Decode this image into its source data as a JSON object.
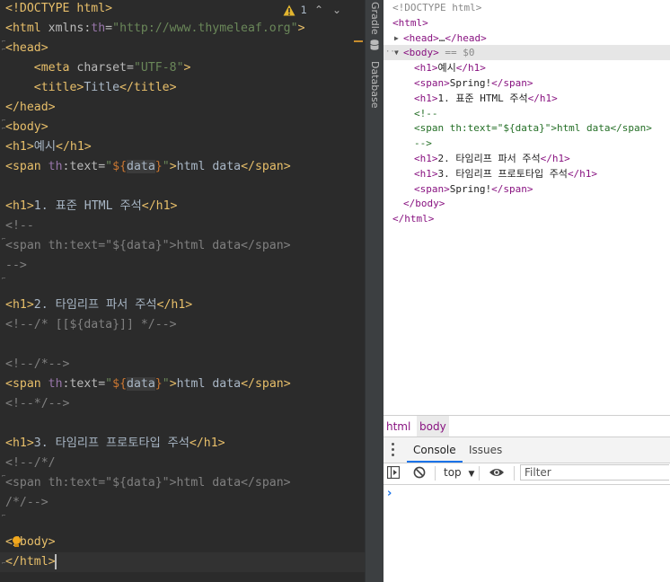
{
  "editor": {
    "warning_count": "1",
    "lines": [
      [
        {
          "c": "t-tag",
          "t": "<!DOCTYPE "
        },
        {
          "c": "t-tag",
          "t": "html"
        },
        {
          "c": "t-tag",
          "t": ">"
        }
      ],
      [
        {
          "c": "t-tag",
          "t": "<html "
        },
        {
          "c": "t-attr",
          "t": "xmlns:"
        },
        {
          "c": "t-ns",
          "t": "th"
        },
        {
          "c": "t-attr",
          "t": "="
        },
        {
          "c": "t-str",
          "t": "\"http://www.thymeleaf.org\""
        },
        {
          "c": "t-tag",
          "t": ">"
        }
      ],
      [
        {
          "c": "t-tag",
          "t": "<head>"
        }
      ],
      [
        {
          "c": "t-txt",
          "t": "    "
        },
        {
          "c": "t-tag",
          "t": "<meta "
        },
        {
          "c": "t-attr",
          "t": "charset="
        },
        {
          "c": "t-str",
          "t": "\"UTF-8\""
        },
        {
          "c": "t-tag",
          "t": ">"
        }
      ],
      [
        {
          "c": "t-txt",
          "t": "    "
        },
        {
          "c": "t-tag",
          "t": "<title>"
        },
        {
          "c": "t-txt",
          "t": "Title"
        },
        {
          "c": "t-tag",
          "t": "</title>"
        }
      ],
      [
        {
          "c": "t-tag",
          "t": "</head>"
        }
      ],
      [
        {
          "c": "t-tag",
          "t": "<body>"
        }
      ],
      [
        {
          "c": "t-tag",
          "t": "<h1>"
        },
        {
          "c": "t-txt",
          "t": "예시"
        },
        {
          "c": "t-tag",
          "t": "</h1>"
        }
      ],
      [
        {
          "c": "t-tag",
          "t": "<span "
        },
        {
          "c": "t-ns",
          "t": "th"
        },
        {
          "c": "t-attr",
          "t": ":text="
        },
        {
          "c": "t-str",
          "t": "\""
        },
        {
          "c": "t-brace",
          "t": "${"
        },
        {
          "c": "t-expr",
          "t": "data"
        },
        {
          "c": "t-brace",
          "t": "}"
        },
        {
          "c": "t-str",
          "t": "\""
        },
        {
          "c": "t-tag",
          "t": ">"
        },
        {
          "c": "t-txt",
          "t": "html data"
        },
        {
          "c": "t-tag",
          "t": "</span>"
        }
      ],
      [],
      [
        {
          "c": "t-tag",
          "t": "<h1>"
        },
        {
          "c": "t-txt",
          "t": "1. 표준 HTML 주석"
        },
        {
          "c": "t-tag",
          "t": "</h1>"
        }
      ],
      [
        {
          "c": "t-cm",
          "t": "<!--"
        }
      ],
      [
        {
          "c": "t-cm",
          "t": "<span th:text=\"${data}\">html data</span>"
        }
      ],
      [
        {
          "c": "t-cm",
          "t": "-->"
        }
      ],
      [],
      [
        {
          "c": "t-tag",
          "t": "<h1>"
        },
        {
          "c": "t-txt",
          "t": "2. 타임리프 파서 주석"
        },
        {
          "c": "t-tag",
          "t": "</h1>"
        }
      ],
      [
        {
          "c": "t-cm",
          "t": "<!--/* [[${data}]] */-->"
        }
      ],
      [],
      [
        {
          "c": "t-cm",
          "t": "<!--/*-->"
        }
      ],
      [
        {
          "c": "t-tag",
          "t": "<span "
        },
        {
          "c": "t-ns",
          "t": "th"
        },
        {
          "c": "t-attr",
          "t": ":text="
        },
        {
          "c": "t-str",
          "t": "\""
        },
        {
          "c": "t-brace",
          "t": "${"
        },
        {
          "c": "t-expr",
          "t": "data"
        },
        {
          "c": "t-brace",
          "t": "}"
        },
        {
          "c": "t-str",
          "t": "\""
        },
        {
          "c": "t-tag",
          "t": ">"
        },
        {
          "c": "t-txt",
          "t": "html data"
        },
        {
          "c": "t-tag",
          "t": "</span>"
        }
      ],
      [
        {
          "c": "t-cm",
          "t": "<!--*/-->"
        }
      ],
      [],
      [
        {
          "c": "t-tag",
          "t": "<h1>"
        },
        {
          "c": "t-txt",
          "t": "3. 타임리프 프로토타입 주석"
        },
        {
          "c": "t-tag",
          "t": "</h1>"
        }
      ],
      [
        {
          "c": "t-cm",
          "t": "<!--/*/"
        }
      ],
      [
        {
          "c": "t-cm",
          "t": "<span th:text=\"${data}\">html data</span>"
        }
      ],
      [
        {
          "c": "t-cm",
          "t": "/*/-->"
        }
      ],
      [],
      [
        {
          "c": "t-tag",
          "t": "</body>"
        }
      ],
      [
        {
          "c": "t-tag",
          "t": "</html>"
        }
      ]
    ]
  },
  "toolstrip": {
    "gradle_label": "Gradle",
    "database_label": "Database"
  },
  "devtools": {
    "elements": [
      {
        "indent": 0,
        "parts": [
          {
            "c": "dt-dim",
            "t": "<!DOCTYPE html>"
          }
        ]
      },
      {
        "indent": 0,
        "parts": [
          {
            "c": "dt-tag",
            "t": "<html>"
          }
        ]
      },
      {
        "indent": 1,
        "arrow": "▶",
        "parts": [
          {
            "c": "dt-tag",
            "t": "<head>"
          },
          {
            "c": "dt-txt",
            "t": "…"
          },
          {
            "c": "dt-tag",
            "t": "</head>"
          }
        ]
      },
      {
        "indent": 1,
        "arrow": "▼",
        "selected": true,
        "parts": [
          {
            "c": "dt-tag",
            "t": "<body>"
          },
          {
            "c": "dt-dim",
            "t": " == $0"
          }
        ]
      },
      {
        "indent": 2,
        "parts": [
          {
            "c": "dt-tag",
            "t": "<h1>"
          },
          {
            "c": "dt-txt",
            "t": "예시"
          },
          {
            "c": "dt-tag",
            "t": "</h1>"
          }
        ]
      },
      {
        "indent": 2,
        "parts": [
          {
            "c": "dt-tag",
            "t": "<span>"
          },
          {
            "c": "dt-txt",
            "t": "Spring!"
          },
          {
            "c": "dt-tag",
            "t": "</span>"
          }
        ]
      },
      {
        "indent": 2,
        "parts": [
          {
            "c": "dt-tag",
            "t": "<h1>"
          },
          {
            "c": "dt-txt",
            "t": "1. 표준 HTML 주석"
          },
          {
            "c": "dt-tag",
            "t": "</h1>"
          }
        ]
      },
      {
        "indent": 2,
        "parts": [
          {
            "c": "dt-cm",
            "t": "<!--"
          }
        ]
      },
      {
        "indent": 2,
        "parts": [
          {
            "c": "dt-cm",
            "t": "<span th:text=\"${data}\">html data</span>"
          }
        ]
      },
      {
        "indent": 2,
        "parts": [
          {
            "c": "dt-cm",
            "t": "-->"
          }
        ]
      },
      {
        "indent": 2,
        "parts": [
          {
            "c": "dt-tag",
            "t": "<h1>"
          },
          {
            "c": "dt-txt",
            "t": "2. 타임리프 파서 주석"
          },
          {
            "c": "dt-tag",
            "t": "</h1>"
          }
        ]
      },
      {
        "indent": 2,
        "parts": [
          {
            "c": "dt-tag",
            "t": "<h1>"
          },
          {
            "c": "dt-txt",
            "t": "3. 타임리프 프로토타입 주석"
          },
          {
            "c": "dt-tag",
            "t": "</h1>"
          }
        ]
      },
      {
        "indent": 2,
        "parts": [
          {
            "c": "dt-tag",
            "t": "<span>"
          },
          {
            "c": "dt-txt",
            "t": "Spring!"
          },
          {
            "c": "dt-tag",
            "t": "</span>"
          }
        ]
      },
      {
        "indent": 1,
        "parts": [
          {
            "c": "dt-tag",
            "t": "</body>"
          }
        ]
      },
      {
        "indent": 0,
        "parts": [
          {
            "c": "dt-tag",
            "t": "</html>"
          }
        ]
      }
    ],
    "breadcrumbs": [
      "html",
      "body"
    ],
    "drawer_tabs": {
      "console": "Console",
      "issues": "Issues"
    },
    "console_toolbar": {
      "context": "top",
      "filter_placeholder": "Filter"
    },
    "prompt_glyph": "›"
  },
  "colors": {
    "editor_bg": "#2b2b2b",
    "current_line_bg": "#323232",
    "accent_blue": "#1a73e8",
    "warning_yellow": "#e2b52f"
  }
}
